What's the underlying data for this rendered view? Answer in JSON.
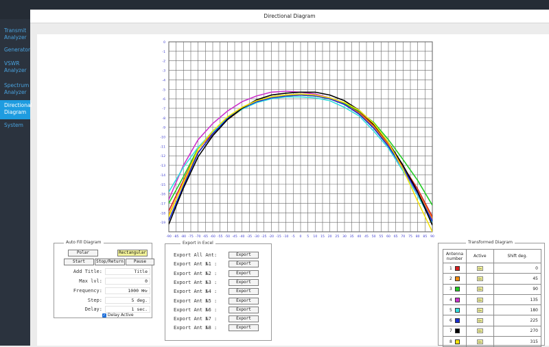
{
  "window": {
    "title": "Directional Diagram"
  },
  "sidebar": {
    "items": [
      {
        "label": "Transmit Analyzer",
        "active": false
      },
      {
        "label": "Generator",
        "active": false
      },
      {
        "label": "VSWR Analyzer",
        "active": false
      },
      {
        "label": "Spectrum Analyzer",
        "active": false
      },
      {
        "label": "Directional Diagram",
        "active": true
      },
      {
        "label": "System",
        "active": false
      }
    ]
  },
  "autofill": {
    "legend": "Auto Fill Diagram",
    "polar_label": "Polar",
    "rect_label": "Rectangular",
    "start_label": "Start",
    "stop_label": "Stop/Return",
    "pause_label": "Pause",
    "title_label": "Add Title:",
    "title_value": "Title",
    "maxlvl_label": "Max lvl:",
    "maxlvl_value": "0",
    "freq_label": "Frequency:",
    "freq_value": "1000",
    "freq_unit": "MHz",
    "step_label": "Step:",
    "step_value": "5 deg.",
    "delay_label": "Delay:",
    "delay_value": "1 sec.",
    "delay_active_label": "Delay Active",
    "delay_active": true
  },
  "export": {
    "legend": "Export in Excel",
    "button_label": "Export",
    "rows": [
      "Export All Ant:",
      "Export Ant №1 :",
      "Export Ant №2 :",
      "Export Ant №3 :",
      "Export Ant №4 :",
      "Export Ant №5 :",
      "Export Ant №6 :",
      "Export Ant №7 :",
      "Export Ant №8 :"
    ]
  },
  "transformed": {
    "legend": "Transformed Diagram",
    "headers": [
      "Antenna number",
      "Active",
      "Shift deg."
    ],
    "on_label": "On",
    "rows": [
      {
        "n": "1",
        "color": "#d62020",
        "shift": "0"
      },
      {
        "n": "2",
        "color": "#f08a10",
        "shift": "45"
      },
      {
        "n": "3",
        "color": "#22cc22",
        "shift": "90"
      },
      {
        "n": "4",
        "color": "#cc33cc",
        "shift": "135"
      },
      {
        "n": "5",
        "color": "#33dddd",
        "shift": "180"
      },
      {
        "n": "6",
        "color": "#1a2fd0",
        "shift": "225"
      },
      {
        "n": "7",
        "color": "#000000",
        "shift": "270"
      },
      {
        "n": "8",
        "color": "#f5e20a",
        "shift": "315"
      }
    ]
  },
  "chart_data": {
    "type": "line",
    "x_ticks": [
      "-90",
      "-85",
      "-80",
      "-75",
      "-70",
      "-65",
      "-60",
      "-55",
      "-50",
      "-45",
      "-40",
      "-35",
      "-30",
      "-25",
      "-20",
      "-15",
      "-10",
      "-5",
      "0",
      "5",
      "10",
      "15",
      "20",
      "25",
      "30",
      "35",
      "40",
      "45",
      "50",
      "55",
      "60",
      "65",
      "70",
      "75",
      "80",
      "85",
      "90"
    ],
    "y_ticks": [
      "0",
      "-1",
      "-2",
      "-3",
      "-4",
      "-5",
      "-6",
      "-7",
      "-8",
      "-9",
      "-10",
      "-11",
      "-12",
      "-13",
      "-14",
      "-15",
      "-16",
      "-17",
      "-18",
      "-19"
    ],
    "xlim": [
      -90,
      90
    ],
    "ylim": [
      -20,
      0
    ],
    "grid": true,
    "series": [
      {
        "color": "#d62020",
        "x": [
          -90,
          -80,
          -70,
          -60,
          -50,
          -40,
          -30,
          -20,
          -10,
          0,
          10,
          20,
          30,
          40,
          50,
          60,
          70,
          80,
          90
        ],
        "y": [
          -17.8,
          -14.6,
          -11.3,
          -9.6,
          -8,
          -6.9,
          -6.2,
          -5.8,
          -5.6,
          -5.5,
          -5.6,
          -5.9,
          -6.5,
          -7.4,
          -8.8,
          -10.8,
          -13.1,
          -15.5,
          -18.4
        ]
      },
      {
        "color": "#f08a10",
        "x": [
          -90,
          -80,
          -70,
          -60,
          -50,
          -40,
          -30,
          -20,
          -10,
          0,
          10,
          20,
          30,
          40,
          50,
          60,
          70,
          80,
          90
        ],
        "y": [
          -18.2,
          -14.9,
          -11.6,
          -9.8,
          -8.2,
          -7.1,
          -6.3,
          -5.9,
          -5.7,
          -5.6,
          -5.7,
          -6,
          -6.6,
          -7.5,
          -8.9,
          -10.9,
          -13.3,
          -15.8,
          -18.6
        ]
      },
      {
        "color": "#22cc22",
        "x": [
          -90,
          -80,
          -70,
          -60,
          -50,
          -40,
          -30,
          -20,
          -10,
          0,
          10,
          20,
          30,
          40,
          50,
          60,
          70,
          80,
          90
        ],
        "y": [
          -17,
          -14.2,
          -11.2,
          -9.4,
          -8,
          -6.9,
          -6.2,
          -5.8,
          -5.6,
          -5.6,
          -5.7,
          -6,
          -6.5,
          -7.3,
          -8.5,
          -10.3,
          -12.4,
          -14.6,
          -17.2
        ]
      },
      {
        "color": "#cc33cc",
        "x": [
          -90,
          -80,
          -70,
          -60,
          -50,
          -40,
          -30,
          -20,
          -10,
          0,
          10,
          20,
          30,
          40,
          50,
          60,
          70,
          80,
          90
        ],
        "y": [
          -16.6,
          -13,
          -10.3,
          -8.6,
          -7.3,
          -6.3,
          -5.7,
          -5.3,
          -5.2,
          -5.3,
          -5.5,
          -5.9,
          -6.6,
          -7.6,
          -9.1,
          -11,
          -13.4,
          -16.1,
          -18.8
        ]
      },
      {
        "color": "#33dddd",
        "x": [
          -90,
          -80,
          -70,
          -60,
          -50,
          -40,
          -30,
          -20,
          -10,
          0,
          10,
          20,
          30,
          40,
          50,
          60,
          70,
          80,
          90
        ],
        "y": [
          -15.8,
          -13.2,
          -11.1,
          -9.5,
          -8.1,
          -7.1,
          -6.4,
          -6,
          -5.8,
          -5.8,
          -5.9,
          -6.2,
          -6.9,
          -7.8,
          -9.4,
          -11.2,
          -13.6,
          -16.2,
          -19
        ]
      },
      {
        "color": "#1a2fd0",
        "x": [
          -90,
          -80,
          -70,
          -60,
          -50,
          -40,
          -30,
          -20,
          -10,
          0,
          10,
          20,
          30,
          40,
          50,
          60,
          70,
          80,
          90
        ],
        "y": [
          -18.8,
          -15.2,
          -11.7,
          -9.7,
          -8.1,
          -7,
          -6.3,
          -5.9,
          -5.7,
          -5.6,
          -5.7,
          -6,
          -6.6,
          -7.6,
          -9.1,
          -11,
          -13.3,
          -15.9,
          -18.9
        ]
      },
      {
        "color": "#000000",
        "x": [
          -90,
          -80,
          -70,
          -60,
          -50,
          -40,
          -30,
          -20,
          -10,
          0,
          10,
          20,
          30,
          40,
          50,
          60,
          70,
          80,
          90
        ],
        "y": [
          -19.2,
          -15.4,
          -12.1,
          -9.9,
          -8.2,
          -7,
          -6.1,
          -5.6,
          -5.4,
          -5.3,
          -5.3,
          -5.6,
          -6.2,
          -7.2,
          -8.7,
          -10.6,
          -13,
          -15.8,
          -19.3
        ]
      },
      {
        "color": "#f5e20a",
        "x": [
          -90,
          -80,
          -70,
          -60,
          -50,
          -40,
          -30,
          -20,
          -10,
          0,
          10,
          20,
          30,
          40,
          50,
          60,
          70,
          80,
          90
        ],
        "y": [
          -18.4,
          -14.8,
          -11.3,
          -9.4,
          -7.9,
          -6.9,
          -6.2,
          -5.8,
          -5.6,
          -5.5,
          -5.6,
          -5.9,
          -6.4,
          -7.2,
          -8.6,
          -10.6,
          -13.4,
          -16.8,
          -20
        ]
      }
    ]
  }
}
